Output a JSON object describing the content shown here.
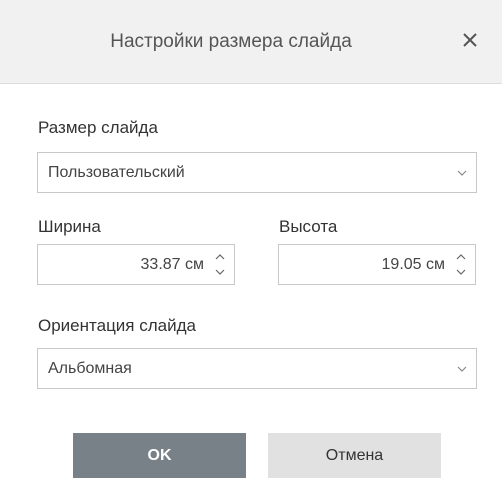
{
  "dialog": {
    "title": "Настройки размера слайда",
    "close_icon": "close-icon"
  },
  "slide_size": {
    "label": "Размер слайда",
    "value": "Пользовательский",
    "arrow_icon": "chevron-down-icon"
  },
  "width": {
    "label": "Ширина",
    "value": "33.87 см",
    "up_icon": "chevron-up-icon",
    "down_icon": "chevron-down-icon"
  },
  "height": {
    "label": "Высота",
    "value": "19.05 см",
    "up_icon": "chevron-up-icon",
    "down_icon": "chevron-down-icon"
  },
  "orientation": {
    "label": "Ориентация слайда",
    "value": "Альбомная",
    "arrow_icon": "chevron-down-icon"
  },
  "buttons": {
    "ok_label": "OK",
    "cancel_label": "Отмена"
  },
  "colors": {
    "header_bg": "#f1f1f1",
    "ok_bg": "#798188",
    "cancel_bg": "#e1e1e1",
    "border": "#c8c8c8"
  }
}
